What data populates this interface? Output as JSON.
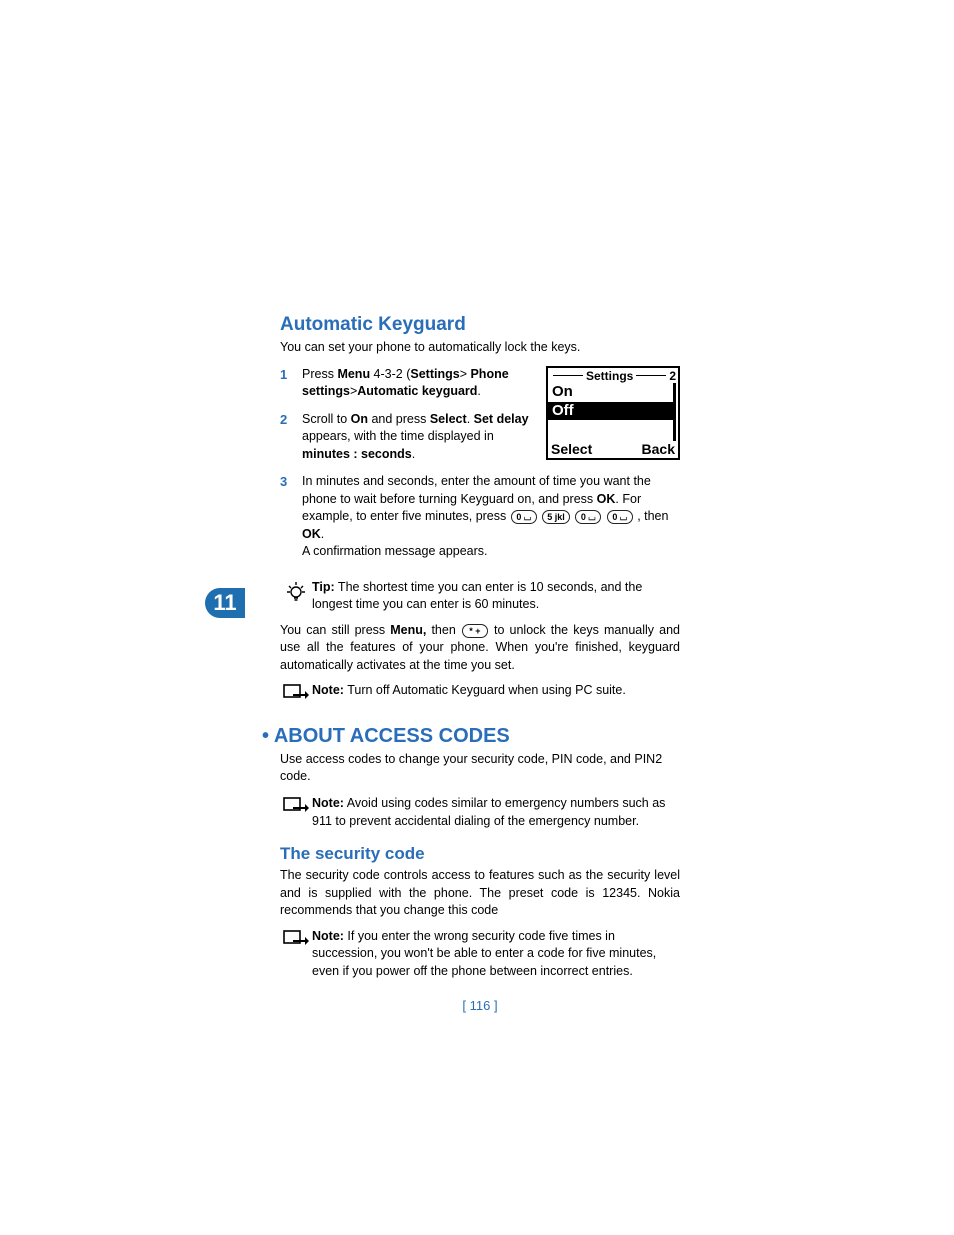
{
  "chapter": "11",
  "page_number": "[ 116 ]",
  "screen": {
    "title": "Settings",
    "index": "2",
    "options": [
      "On",
      "Off"
    ],
    "selected": "Off",
    "left_softkey": "Select",
    "right_softkey": "Back"
  },
  "section1": {
    "heading": "Automatic Keyguard",
    "intro": "You can set your phone to automatically lock the keys.",
    "step1_a": "Press ",
    "step1_menu": "Menu",
    "step1_b": " 4-3-2 (",
    "step1_c": "Settings",
    "step1_d": "> ",
    "step1_e": "Phone settings",
    "step1_f": ">",
    "step1_g": "Automatic keyguard",
    "step1_h": ".",
    "step2_a": "Scroll to ",
    "step2_on": "On",
    "step2_b": " and press ",
    "step2_sel": "Select",
    "step2_c": ". ",
    "step2_d": "Set delay",
    "step2_e": " appears, with the time displayed in ",
    "step2_f": "minutes : seconds",
    "step2_g": ".",
    "step3_a": "In minutes and seconds, enter the amount of time you want the phone to wait before turning Keyguard on, and press ",
    "step3_ok": "OK",
    "step3_b": ". For example, to enter five minutes, press ",
    "step3_keys": [
      "0 ⌴",
      "5 jkl",
      "0 ⌴",
      "0 ⌴"
    ],
    "step3_c": ", then ",
    "step3_ok2": "OK",
    "step3_d": ".",
    "step3_e": "A confirmation message appears."
  },
  "tip": {
    "label": "Tip:",
    "text": " The shortest time you can enter is 10 seconds, and the longest time you can enter is 60 minutes."
  },
  "para": {
    "a": "You can still press ",
    "menu": "Menu,",
    "b": " then ",
    "key": "* +",
    "c": " to unlock the keys manually and use all the features of your phone. When you're finished, keyguard automatically activates at the time you set."
  },
  "note1": {
    "label": "Note:",
    "text": " Turn off Automatic Keyguard when using PC suite."
  },
  "section2": {
    "heading": "ABOUT ACCESS CODES",
    "intro": "Use access codes to change your security code, PIN code, and PIN2 code."
  },
  "note2": {
    "label": "Note:",
    "text": " Avoid using codes similar to emergency numbers such as 911 to prevent accidental dialing of the emergency number."
  },
  "section3": {
    "heading": "The security code",
    "body": "The security code controls access to features such as the security level and is supplied with the phone. The preset code is 12345. Nokia recommends that you change this code"
  },
  "note3": {
    "label": "Note:",
    "text": " If you enter the wrong security code five times in succession, you won't be able to enter a code for five minutes, even if you power off the phone between incorrect entries."
  }
}
